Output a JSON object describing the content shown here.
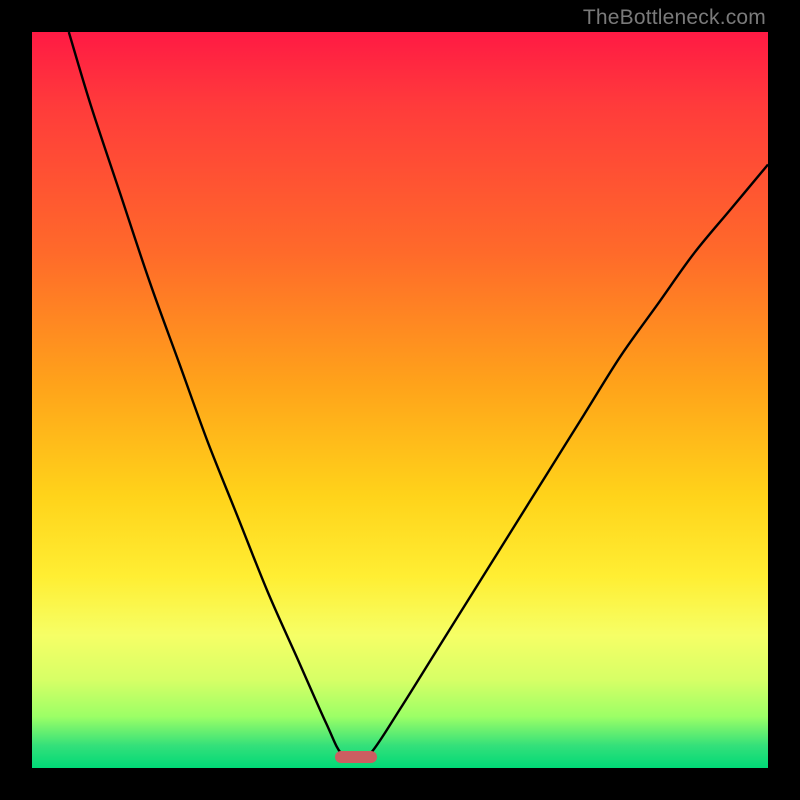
{
  "watermark": "TheBottleneck.com",
  "colors": {
    "frame": "#000000",
    "watermark": "#7a7a7a",
    "curve": "#000000",
    "marker": "#cc5e61",
    "gradient_stops": [
      "#ff1a44",
      "#ff3b3b",
      "#ff6a2a",
      "#ffa31a",
      "#ffd31a",
      "#ffee33",
      "#f6ff66",
      "#d7ff66",
      "#9cff66",
      "#33e07a",
      "#00d977"
    ]
  },
  "chart_data": {
    "type": "line",
    "title": "",
    "xlabel": "",
    "ylabel": "",
    "xlim": [
      0,
      100
    ],
    "ylim": [
      0,
      100
    ],
    "annotations": [
      {
        "text": "TheBottleneck.com",
        "position": "top-right"
      }
    ],
    "marker": {
      "x": 44,
      "y": 1.5,
      "shape": "pill",
      "color": "#cc5e61"
    },
    "series": [
      {
        "name": "left-branch",
        "x": [
          5,
          8,
          12,
          16,
          20,
          24,
          28,
          32,
          36,
          40,
          42
        ],
        "values": [
          100,
          90,
          78,
          66,
          55,
          44,
          34,
          24,
          15,
          6,
          2
        ]
      },
      {
        "name": "right-branch",
        "x": [
          46,
          50,
          55,
          60,
          65,
          70,
          75,
          80,
          85,
          90,
          95,
          100
        ],
        "values": [
          2,
          8,
          16,
          24,
          32,
          40,
          48,
          56,
          63,
          70,
          76,
          82
        ]
      }
    ],
    "background_gradient": {
      "direction": "top-to-bottom",
      "stops": [
        {
          "pct": 0,
          "color": "#ff1a44"
        },
        {
          "pct": 30,
          "color": "#ff6a2a"
        },
        {
          "pct": 63,
          "color": "#ffd31a"
        },
        {
          "pct": 82,
          "color": "#f6ff66"
        },
        {
          "pct": 97,
          "color": "#33e07a"
        },
        {
          "pct": 100,
          "color": "#00d977"
        }
      ]
    }
  }
}
